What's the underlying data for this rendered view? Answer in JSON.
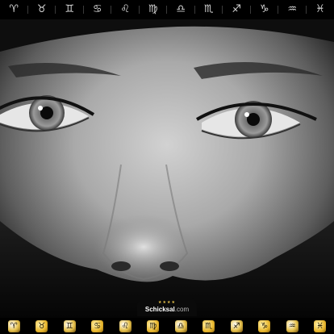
{
  "zodiac_symbols": [
    {
      "glyph": "♈",
      "icon": "aries-icon"
    },
    {
      "glyph": "♉",
      "icon": "taurus-icon"
    },
    {
      "glyph": "♊",
      "icon": "gemini-icon"
    },
    {
      "glyph": "♋",
      "icon": "cancer-icon"
    },
    {
      "glyph": "♌",
      "icon": "leo-icon"
    },
    {
      "glyph": "♍",
      "icon": "virgo-icon"
    },
    {
      "glyph": "♎",
      "icon": "libra-icon"
    },
    {
      "glyph": "♏",
      "icon": "scorpio-icon"
    },
    {
      "glyph": "♐",
      "icon": "sagittarius-icon"
    },
    {
      "glyph": "♑",
      "icon": "capricorn-icon"
    },
    {
      "glyph": "♒",
      "icon": "aquarius-icon"
    },
    {
      "glyph": "♓",
      "icon": "pisces-icon"
    }
  ],
  "zodiac_images": [
    {
      "glyph": "♈",
      "icon": "aries-image-icon"
    },
    {
      "glyph": "♉",
      "icon": "taurus-image-icon"
    },
    {
      "glyph": "♊",
      "icon": "gemini-image-icon"
    },
    {
      "glyph": "♋",
      "icon": "cancer-image-icon"
    },
    {
      "glyph": "♌",
      "icon": "leo-image-icon"
    },
    {
      "glyph": "♍",
      "icon": "virgo-image-icon"
    },
    {
      "glyph": "♎",
      "icon": "libra-image-icon"
    },
    {
      "glyph": "♏",
      "icon": "scorpio-image-icon"
    },
    {
      "glyph": "♐",
      "icon": "sagittarius-image-icon"
    },
    {
      "glyph": "♑",
      "icon": "capricorn-image-icon"
    },
    {
      "glyph": "♒",
      "icon": "aquarius-image-icon"
    },
    {
      "glyph": "♓",
      "icon": "pisces-image-icon"
    }
  ],
  "brand": {
    "name": "Schicksal",
    "domain": ".com"
  },
  "colors": {
    "bar_background": "#000000",
    "symbol_color": "#d8d8d8",
    "icon_gold": "#e8b62c"
  }
}
